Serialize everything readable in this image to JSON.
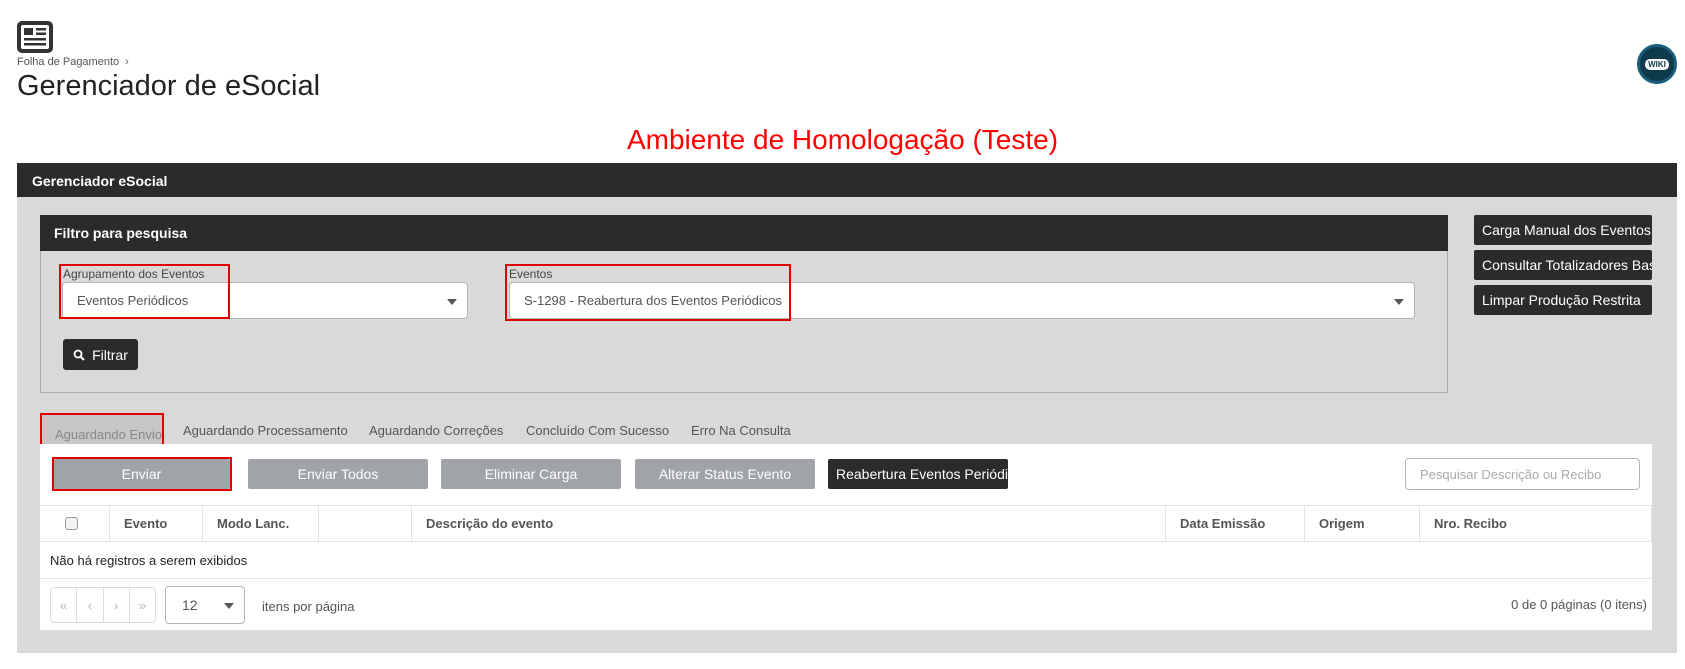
{
  "breadcrumb": {
    "item": "Folha de Pagamento",
    "separator": "›"
  },
  "page": {
    "title": "Gerenciador de eSocial",
    "wiki_label": "WIKI"
  },
  "environment": {
    "banner": "Ambiente de Homologação (Teste)",
    "color": "#ff0000"
  },
  "main_panel": {
    "title": "Gerenciador eSocial"
  },
  "filter": {
    "title": "Filtro para pesquisa",
    "group_label": "Agrupamento dos Eventos",
    "group_value": "Eventos Periódicos",
    "events_label": "Eventos",
    "events_value": "S-1298 - Reabertura dos Eventos Periódicos",
    "filter_button": "Filtrar"
  },
  "side_buttons": [
    {
      "label": "Carga Manual dos Eventos"
    },
    {
      "label": "Consultar Totalizadores Base"
    },
    {
      "label": "Limpar Produção Restrita"
    }
  ],
  "tabs": [
    {
      "label": "Aguardando Envio",
      "active": true
    },
    {
      "label": "Aguardando Processamento"
    },
    {
      "label": "Aguardando Correções"
    },
    {
      "label": "Concluído Com Sucesso"
    },
    {
      "label": "Erro Na Consulta"
    }
  ],
  "actions": {
    "send": "Enviar",
    "send_all": "Enviar Todos",
    "delete_load": "Eliminar Carga",
    "change_status": "Alterar Status Evento",
    "reopen": "Reabertura Eventos Periódic",
    "search_placeholder": "Pesquisar Descrição ou Recibo"
  },
  "table": {
    "columns": [
      "Evento",
      "Modo Lanc.",
      "",
      "Descrição do evento",
      "Data Emissão",
      "Origem",
      "Nro. Recibo"
    ],
    "empty_message": "Não há registros a serem exibidos"
  },
  "pager": {
    "first": "«",
    "prev": "‹",
    "next": "›",
    "last": "»",
    "page_size": "12",
    "per_page_label": "itens por página",
    "info": "0 de 0 páginas (0 itens)"
  },
  "colors": {
    "dark": "#2b2b2b",
    "panel": "#d9d9d9",
    "highlight": "#e00000",
    "disabled_button": "#a0a4a8"
  }
}
